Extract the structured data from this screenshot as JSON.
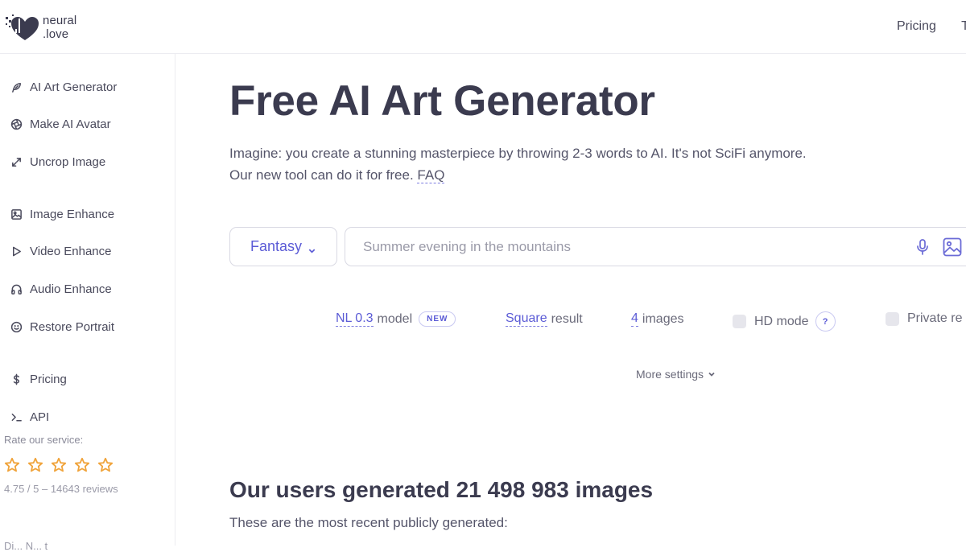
{
  "header": {
    "logo_line1": "neural",
    "logo_line2": ".love",
    "nav": [
      "Pricing",
      "T"
    ]
  },
  "sidebar": {
    "items": [
      {
        "label": "AI Art Generator",
        "icon": "feather-icon"
      },
      {
        "label": "Make AI Avatar",
        "icon": "aperture-icon"
      },
      {
        "label": "Uncrop Image",
        "icon": "expand-icon"
      },
      {
        "label": "Image Enhance",
        "icon": "image-icon"
      },
      {
        "label": "Video Enhance",
        "icon": "play-icon"
      },
      {
        "label": "Audio Enhance",
        "icon": "headphones-icon"
      },
      {
        "label": "Restore Portrait",
        "icon": "smile-icon"
      },
      {
        "label": "Pricing",
        "icon": "dollar-icon"
      },
      {
        "label": "API",
        "icon": "terminal-icon"
      }
    ],
    "rating": {
      "label": "Rate our service:",
      "stars": 5,
      "stats": "4.75 / 5 – 14643 reviews",
      "star_color": "#f0a33a"
    },
    "cut_text": "Di... N... t"
  },
  "main": {
    "title": "Free AI Art Generator",
    "subtitle_line1": "Imagine: you create a stunning masterpiece by throwing 2-3 words to AI. It's not SciFi anymore.",
    "subtitle_line2": "Our new tool can do it for free.",
    "faq_label": "FAQ",
    "style_select": "Fantasy",
    "prompt_placeholder": "Summer evening in the mountains",
    "options": {
      "model_link": "NL 0.3",
      "model_text": "model",
      "model_badge": "NEW",
      "shape_link": "Square",
      "shape_text": "result",
      "count_link": "4",
      "count_text": "images",
      "hd_label": "HD mode",
      "hd_help": "?",
      "private_label": "Private re"
    },
    "more_settings": "More settings",
    "users_heading": "Our users generated 21 498 983 images",
    "users_sub": "These are the most recent publicly generated:"
  },
  "colors": {
    "accent": "#5b5bd6",
    "text": "#3b3b4f",
    "border": "#d9d9e3",
    "star": "#f0a33a"
  }
}
